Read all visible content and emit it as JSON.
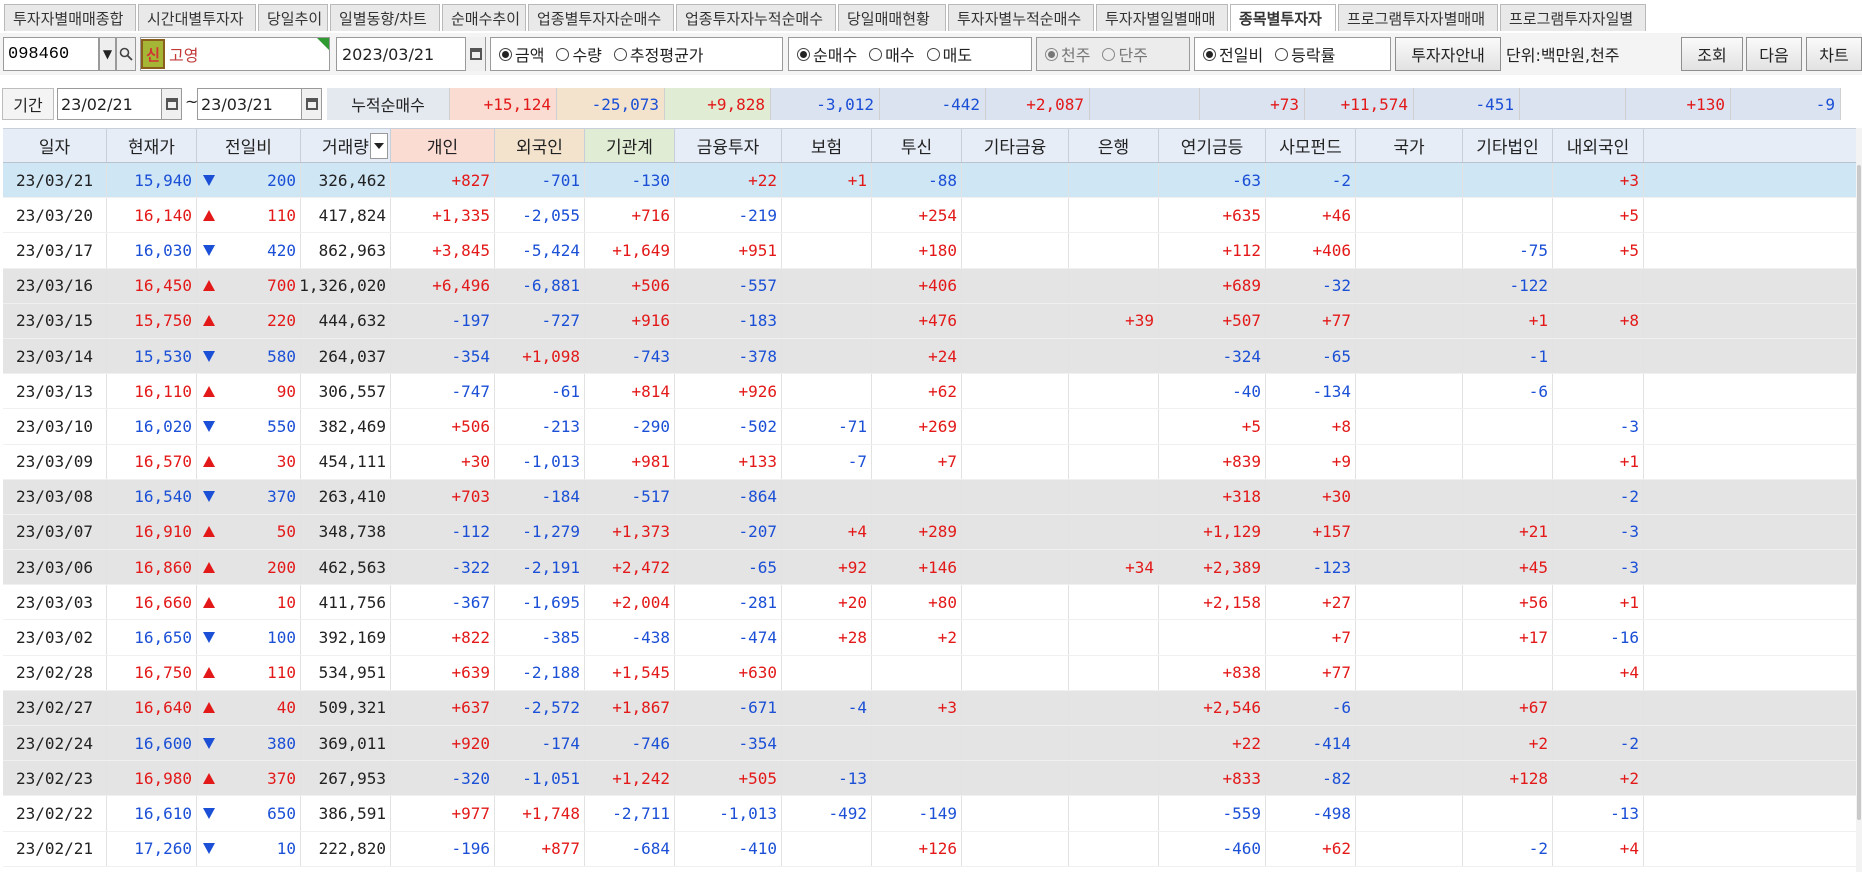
{
  "tabs": [
    {
      "label": "투자자별매매종합",
      "w": 132
    },
    {
      "label": "시간대별투자자",
      "w": 118
    },
    {
      "label": "당일추이",
      "w": 70
    },
    {
      "label": "일별동향/차트",
      "w": 110
    },
    {
      "label": "순매수추이",
      "w": 84
    },
    {
      "label": "업종별투자자순매수",
      "w": 146
    },
    {
      "label": "업종투자자누적순매수",
      "w": 160
    },
    {
      "label": "당일매매현황",
      "w": 108
    },
    {
      "label": "투자자별누적순매수",
      "w": 146
    },
    {
      "label": "투자자별일별매매",
      "w": 132
    },
    {
      "label": "종목별투자자",
      "w": 106,
      "active": true
    },
    {
      "label": "프로그램투자자별매매",
      "w": 160
    },
    {
      "label": "프로그램투자자일별",
      "w": 146
    }
  ],
  "controls": {
    "stock_code": "098460",
    "sin_badge": "신",
    "stock_name": "고영",
    "date": "2023/03/21",
    "amount_options": [
      {
        "label": "금액",
        "on": true
      },
      {
        "label": "수량",
        "on": false
      },
      {
        "label": "추정평균가",
        "on": false
      }
    ],
    "trade_options": [
      {
        "label": "순매수",
        "on": true
      },
      {
        "label": "매수",
        "on": false
      },
      {
        "label": "매도",
        "on": false
      }
    ],
    "unit_options": [
      {
        "label": "천주",
        "on": true
      },
      {
        "label": "단주",
        "on": false
      }
    ],
    "compare_options": [
      {
        "label": "전일비",
        "on": true
      },
      {
        "label": "등락률",
        "on": false
      }
    ],
    "guide_button": "투자자안내",
    "unit_label": "단위:백만원,천주",
    "search_button": "조회",
    "next_button": "다음",
    "chart_button": "차트"
  },
  "period": {
    "label": "기간",
    "from": "23/02/21",
    "to": "23/03/21",
    "tilde": "~",
    "cumulative_label": "누적순매수",
    "sums": [
      "+15,124",
      "-25,073",
      "+9,828",
      "-3,012",
      "-442",
      "+2,087",
      "",
      "+73",
      "+11,574",
      "-451",
      "",
      "+130",
      "-9"
    ]
  },
  "headers": [
    "일자",
    "현재가",
    "전일비",
    "거래량",
    "개인",
    "외국인",
    "기관계",
    "금융투자",
    "보험",
    "투신",
    "기타금융",
    "은행",
    "연기금등",
    "사모펀드",
    "국가",
    "기타법인",
    "내외국인"
  ],
  "rows": [
    {
      "date": "23/03/21",
      "price": "15,940",
      "dir": "dn",
      "chg": "200",
      "vol": "326,462",
      "v": [
        "+827",
        "-701",
        "-130",
        "+22",
        "+1",
        "-88",
        "",
        "",
        "-63",
        "-2",
        "",
        "",
        "+3"
      ]
    },
    {
      "date": "23/03/20",
      "price": "16,140",
      "dir": "up",
      "chg": "110",
      "vol": "417,824",
      "v": [
        "+1,335",
        "-2,055",
        "+716",
        "-219",
        "",
        "+254",
        "",
        "",
        "+635",
        "+46",
        "",
        "",
        "+5"
      ]
    },
    {
      "date": "23/03/17",
      "price": "16,030",
      "dir": "dn",
      "chg": "420",
      "vol": "862,963",
      "v": [
        "+3,845",
        "-5,424",
        "+1,649",
        "+951",
        "",
        "+180",
        "",
        "",
        "+112",
        "+406",
        "",
        "-75",
        "+5"
      ]
    },
    {
      "date": "23/03/16",
      "price": "16,450",
      "dir": "up",
      "chg": "700",
      "vol": "1,326,020",
      "v": [
        "+6,496",
        "-6,881",
        "+506",
        "-557",
        "",
        "+406",
        "",
        "",
        "+689",
        "-32",
        "",
        "-122",
        ""
      ]
    },
    {
      "date": "23/03/15",
      "price": "15,750",
      "dir": "up",
      "chg": "220",
      "vol": "444,632",
      "v": [
        "-197",
        "-727",
        "+916",
        "-183",
        "",
        "+476",
        "",
        "+39",
        "+507",
        "+77",
        "",
        "+1",
        "+8"
      ]
    },
    {
      "date": "23/03/14",
      "price": "15,530",
      "dir": "dn",
      "chg": "580",
      "vol": "264,037",
      "v": [
        "-354",
        "+1,098",
        "-743",
        "-378",
        "",
        "+24",
        "",
        "",
        "-324",
        "-65",
        "",
        "-1",
        ""
      ]
    },
    {
      "date": "23/03/13",
      "price": "16,110",
      "dir": "up",
      "chg": "90",
      "vol": "306,557",
      "v": [
        "-747",
        "-61",
        "+814",
        "+926",
        "",
        "+62",
        "",
        "",
        "-40",
        "-134",
        "",
        "-6",
        ""
      ]
    },
    {
      "date": "23/03/10",
      "price": "16,020",
      "dir": "dn",
      "chg": "550",
      "vol": "382,469",
      "v": [
        "+506",
        "-213",
        "-290",
        "-502",
        "-71",
        "+269",
        "",
        "",
        "+5",
        "+8",
        "",
        "",
        "-3"
      ]
    },
    {
      "date": "23/03/09",
      "price": "16,570",
      "dir": "up",
      "chg": "30",
      "vol": "454,111",
      "v": [
        "+30",
        "-1,013",
        "+981",
        "+133",
        "-7",
        "+7",
        "",
        "",
        "+839",
        "+9",
        "",
        "",
        "+1"
      ]
    },
    {
      "date": "23/03/08",
      "price": "16,540",
      "dir": "dn",
      "chg": "370",
      "vol": "263,410",
      "v": [
        "+703",
        "-184",
        "-517",
        "-864",
        "",
        "",
        "",
        "",
        "+318",
        "+30",
        "",
        "",
        "-2"
      ]
    },
    {
      "date": "23/03/07",
      "price": "16,910",
      "dir": "up",
      "chg": "50",
      "vol": "348,738",
      "v": [
        "-112",
        "-1,279",
        "+1,373",
        "-207",
        "+4",
        "+289",
        "",
        "",
        "+1,129",
        "+157",
        "",
        "+21",
        "-3"
      ]
    },
    {
      "date": "23/03/06",
      "price": "16,860",
      "dir": "up",
      "chg": "200",
      "vol": "462,563",
      "v": [
        "-322",
        "-2,191",
        "+2,472",
        "-65",
        "+92",
        "+146",
        "",
        "+34",
        "+2,389",
        "-123",
        "",
        "+45",
        "-3"
      ]
    },
    {
      "date": "23/03/03",
      "price": "16,660",
      "dir": "up",
      "chg": "10",
      "vol": "411,756",
      "v": [
        "-367",
        "-1,695",
        "+2,004",
        "-281",
        "+20",
        "+80",
        "",
        "",
        "+2,158",
        "+27",
        "",
        "+56",
        "+1"
      ]
    },
    {
      "date": "23/03/02",
      "price": "16,650",
      "dir": "dn",
      "chg": "100",
      "vol": "392,169",
      "v": [
        "+822",
        "-385",
        "-438",
        "-474",
        "+28",
        "+2",
        "",
        "",
        "",
        "+7",
        "",
        "+17",
        "-16"
      ]
    },
    {
      "date": "23/02/28",
      "price": "16,750",
      "dir": "up",
      "chg": "110",
      "vol": "534,951",
      "v": [
        "+639",
        "-2,188",
        "+1,545",
        "+630",
        "",
        "",
        "",
        "",
        "+838",
        "+77",
        "",
        "",
        "+4"
      ]
    },
    {
      "date": "23/02/27",
      "price": "16,640",
      "dir": "up",
      "chg": "40",
      "vol": "509,321",
      "v": [
        "+637",
        "-2,572",
        "+1,867",
        "-671",
        "-4",
        "+3",
        "",
        "",
        "+2,546",
        "-6",
        "",
        "+67",
        ""
      ]
    },
    {
      "date": "23/02/24",
      "price": "16,600",
      "dir": "dn",
      "chg": "380",
      "vol": "369,011",
      "v": [
        "+920",
        "-174",
        "-746",
        "-354",
        "",
        "",
        "",
        "",
        "+22",
        "-414",
        "",
        "+2",
        "-2"
      ]
    },
    {
      "date": "23/02/23",
      "price": "16,980",
      "dir": "up",
      "chg": "370",
      "vol": "267,953",
      "v": [
        "-320",
        "-1,051",
        "+1,242",
        "+505",
        "-13",
        "",
        "",
        "",
        "+833",
        "-82",
        "",
        "+128",
        "+2"
      ]
    },
    {
      "date": "23/02/22",
      "price": "16,610",
      "dir": "dn",
      "chg": "650",
      "vol": "386,591",
      "v": [
        "+977",
        "+1,748",
        "-2,711",
        "-1,013",
        "-492",
        "-149",
        "",
        "",
        "-559",
        "-498",
        "",
        "",
        "-13"
      ]
    },
    {
      "date": "23/02/21",
      "price": "17,260",
      "dir": "dn",
      "chg": "10",
      "vol": "222,820",
      "v": [
        "-196",
        "+877",
        "-684",
        "-410",
        "",
        "+126",
        "",
        "",
        "-460",
        "+62",
        "",
        "-2",
        "+4"
      ]
    }
  ],
  "colors": {
    "up": "#e31919",
    "down": "#1a4fd6",
    "selected_row": "#cfe6f5",
    "shaded_row": "#e4e4e4",
    "individual_bg": "#fadcd3",
    "foreign_bg": "#f3e3cd",
    "institution_bg": "#e0ecd3",
    "sum_bg": "#dbe3f0"
  }
}
